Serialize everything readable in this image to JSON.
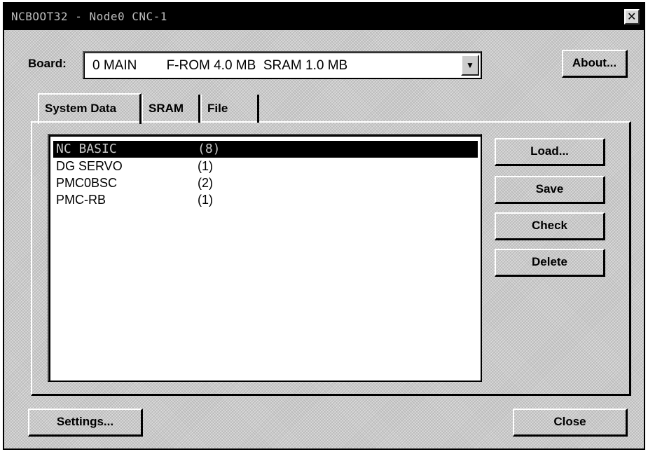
{
  "window": {
    "title": "NCBOOT32 - Node0  CNC-1",
    "close_glyph": "✕"
  },
  "board": {
    "label": "Board:",
    "value": "0 MAIN        F-ROM 4.0 MB  SRAM 1.0 MB",
    "dropdown_glyph": "▼"
  },
  "buttons": {
    "about": "About...",
    "load": "Load...",
    "save": "Save",
    "check": "Check",
    "delete": "Delete",
    "settings": "Settings...",
    "close": "Close"
  },
  "tabs": [
    {
      "label": "System Data",
      "active": true
    },
    {
      "label": "SRAM",
      "active": false
    },
    {
      "label": "File",
      "active": false
    }
  ],
  "list": {
    "items": [
      {
        "name": "NC BASIC",
        "count": "(8)",
        "selected": true
      },
      {
        "name": "DG SERVO",
        "count": "(1)",
        "selected": false
      },
      {
        "name": "PMC0BSC",
        "count": "(2)",
        "selected": false
      },
      {
        "name": "PMC-RB",
        "count": "(1)",
        "selected": false
      }
    ]
  }
}
